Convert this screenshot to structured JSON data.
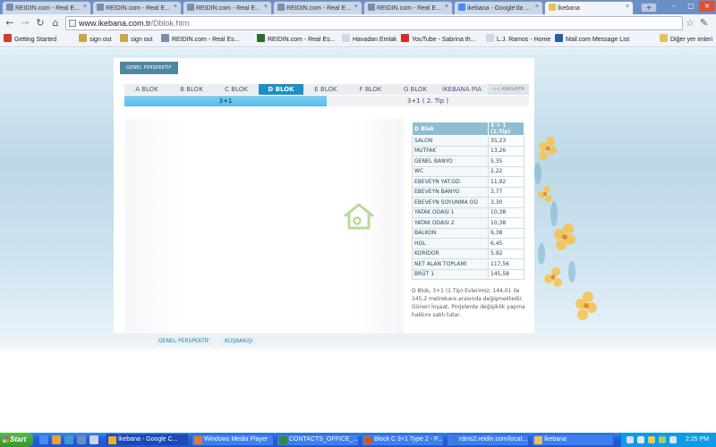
{
  "browser": {
    "tabs": [
      {
        "title": "REIDIN.com - Real E...",
        "close": "×"
      },
      {
        "title": "REIDIN.com - Real E...",
        "close": "×"
      },
      {
        "title": "REIDIN.com - Real E...",
        "close": "×"
      },
      {
        "title": "REIDIN.com - Real E...",
        "close": "×"
      },
      {
        "title": "REIDIN.com - Real E...",
        "close": "×"
      },
      {
        "title": "ikebana - Google'da ...",
        "close": "×"
      },
      {
        "title": "İkebana",
        "close": "×"
      }
    ],
    "new_tab": "+",
    "window_controls": [
      "–",
      "□",
      "×"
    ],
    "nav": {
      "back": "←",
      "forward": "→",
      "reload": "↻",
      "home": "⌂"
    },
    "url_host": "www.ikebana.com.tr",
    "url_path": "/Dblok.htm",
    "star": "☆",
    "wrench": "✎",
    "bookmarks": [
      {
        "label": "Getting Started",
        "color": "#d63b2a"
      },
      {
        "label": "sign out",
        "color": "#c6a84a"
      },
      {
        "label": "sign out",
        "color": "#c6a84a"
      },
      {
        "label": "REIDIN.com - Real Es...",
        "color": "#7c8fa6"
      },
      {
        "label": "REIDIN.com - Real Es...",
        "color": "#2a6a2a"
      },
      {
        "label": "Havadan Emlak",
        "color": "#cfd8e3"
      },
      {
        "label": "YouTube - Sabrina th...",
        "color": "#d62a2a"
      },
      {
        "label": "L.J. Ramos - Home",
        "color": "#cfd8e3"
      },
      {
        "label": "Mail.com Message List",
        "color": "#2a5aa8"
      },
      {
        "label": "Diğer yer imleri",
        "color": "#e8c060"
      }
    ]
  },
  "site": {
    "header_tab": "GENEL PERSPEKTİF",
    "block_tabs": [
      "A BLOK",
      "B BLOK",
      "C BLOK",
      "D BLOK",
      "E BLOK",
      "F BLOK",
      "G BLOK",
      "İKEBANA PIA",
      "<< ANASAYFA"
    ],
    "type_tabs": [
      "3+1",
      "3+1 ( 2. Tip )"
    ],
    "table": {
      "header": [
        "D Blok",
        "3 + 1 (1.Tip)"
      ],
      "rows": [
        [
          "SALON",
          "35,23"
        ],
        [
          "MUTFAK",
          "13,26"
        ],
        [
          "GENEL BANYO",
          "5,35"
        ],
        [
          "WC",
          "2,22"
        ],
        [
          "EBEVEYN YAT.OD.",
          "11,92"
        ],
        [
          "EBEVEYN BANYO",
          "3,77"
        ],
        [
          "EBEVEYN SOYUNMA OD",
          "3,30"
        ],
        [
          "YATAK ODASI 1",
          "10,38"
        ],
        [
          "YATAK ODASI 2",
          "10,38"
        ],
        [
          "BALKON",
          "9,38"
        ],
        [
          "HOL",
          "6,45"
        ],
        [
          "KORİDOR",
          "5,92"
        ],
        [
          "NET ALAN TOPLAMI",
          "117,56"
        ],
        [
          "BRÜT 1",
          "145,58"
        ]
      ]
    },
    "description": "D Blok, 3+1 (1.Tip) Evlerimiz; 144,01 ile 145,2 metrekare arasında değişmektedir. Güneri İnşaat, Projelerde değişiklik yapma hakkını saklı tutar.",
    "footer_links": [
      "GENEL PERSPEKTİF",
      "KUŞBAKIŞI"
    ],
    "accent": "#1e8fc6",
    "logo_color": "#b9d89a"
  },
  "taskbar": {
    "start": "Start",
    "tasks": [
      {
        "label": "İkebana - Google C...",
        "color": "#e2b233"
      },
      {
        "label": "Windows Media Player",
        "color": "#e07a2a"
      },
      {
        "label": "CONTACTS_OFFICE_...",
        "color": "#2f8a3a"
      },
      {
        "label": "Block C 3+1 Type 2 - P...",
        "color": "#c85a2a"
      },
      {
        "label": "rdms2.reidin.com/locat...",
        "color": "#3a7ad8"
      },
      {
        "label": "İkebana",
        "color": "#e8c060"
      }
    ],
    "clock": "2:25 PM"
  }
}
